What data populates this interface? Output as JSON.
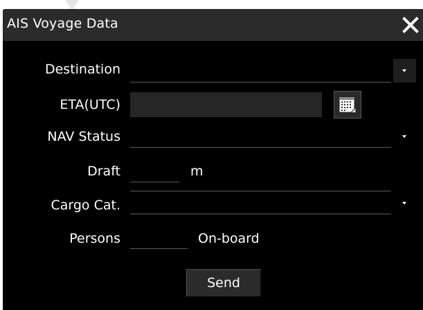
{
  "window": {
    "title": "AIS Voyage Data"
  },
  "form": {
    "destination": {
      "label": "Destination",
      "value": ""
    },
    "eta": {
      "label": "ETA(UTC)",
      "value": ""
    },
    "nav_status": {
      "label": "NAV Status",
      "value": ""
    },
    "draft": {
      "label": "Draft",
      "value": "",
      "unit": "m"
    },
    "cargo_category": {
      "label": "Cargo Cat.",
      "value": ""
    },
    "persons": {
      "label": "Persons",
      "value": "",
      "unit": "On-board"
    }
  },
  "actions": {
    "send_label": "Send"
  },
  "colors": {
    "dialog_background": "#000000",
    "titlebar_background": "#2b2b2b",
    "text": "#ffffff",
    "field_background": "#262626"
  },
  "icons": {
    "close": "close-icon",
    "calendar": "calendar-icon",
    "dropdown": "chevron-down-icon"
  }
}
